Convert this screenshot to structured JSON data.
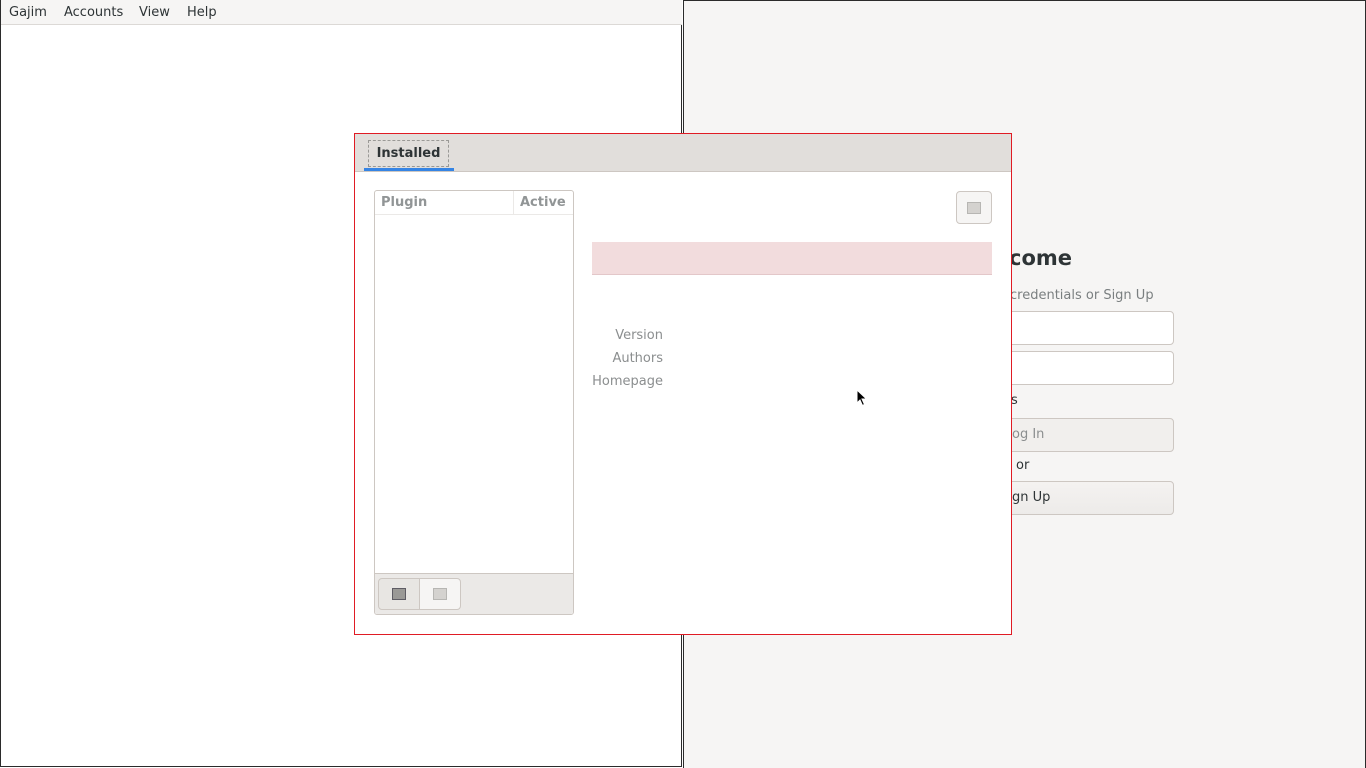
{
  "main_window": {
    "menu": [
      "Gajim",
      "Accounts",
      "View",
      "Help"
    ]
  },
  "account_wizard": {
    "welcome_title": "come",
    "welcome_subtitle": "credentials or Sign Up",
    "advanced_label": "s",
    "login_button": "og In",
    "or_label": "or",
    "signup_button": "gn Up"
  },
  "plugins_dialog": {
    "tabs": [
      {
        "label": "Installed",
        "active": true
      }
    ],
    "list_columns": [
      "Plugin",
      "Active"
    ],
    "plugins": [],
    "details": {
      "version_label": "Version",
      "authors_label": "Authors",
      "homepage_label": "Homepage"
    },
    "icons": {
      "install": "install-from-zip-icon",
      "uninstall": "uninstall-icon",
      "configure": "configure-icon"
    },
    "colors": {
      "dialog_border": "#e01b24",
      "tab_underline": "#3584e4",
      "warning_bar": "#f2dcdd"
    }
  }
}
